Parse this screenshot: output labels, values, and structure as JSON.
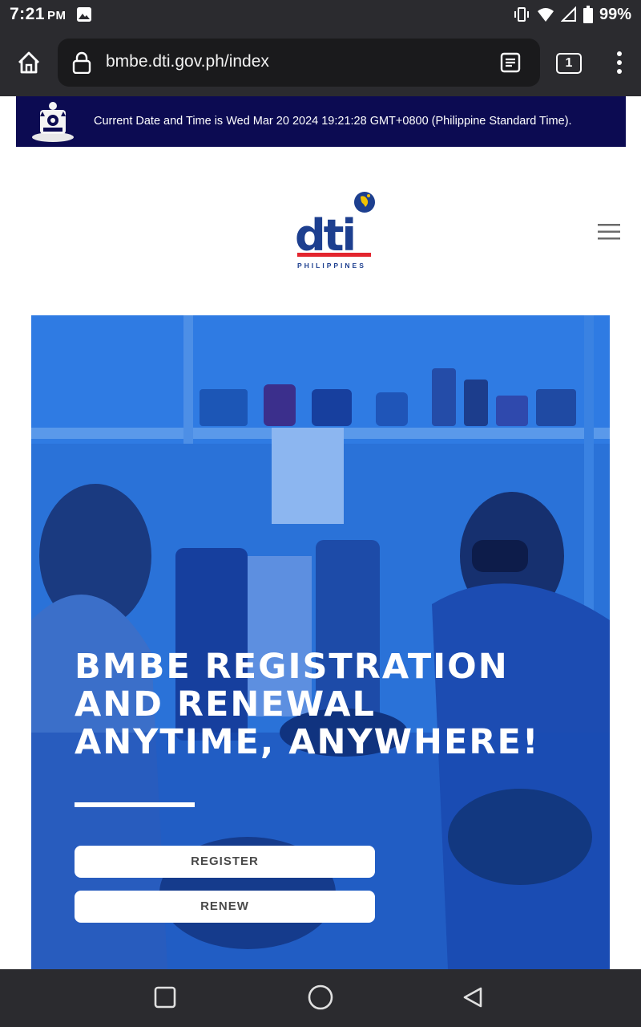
{
  "status_bar": {
    "time": "7:21",
    "ampm": "PM",
    "battery": "99%",
    "icons": [
      "image-icon",
      "vibrate-icon",
      "wifi-icon",
      "signal-icon",
      "battery-icon"
    ]
  },
  "browser": {
    "url": "bmbe.dti.gov.ph/index",
    "tab_count": "1",
    "icons": [
      "home-icon",
      "lock-icon",
      "reader-mode-icon",
      "tabs-icon",
      "overflow-menu-icon"
    ]
  },
  "gov_banner": {
    "text": "Current Date and Time is Wed Mar 20 2024 19:21:28 GMT+0800 (Philippine Standard Time).",
    "seal_icon": "philippine-seal-icon",
    "bg_color": "#0c0b52"
  },
  "header": {
    "logo_text": "dti",
    "logo_subtitle": "PHILIPPINES",
    "menu_icon": "hamburger-icon"
  },
  "hero": {
    "title": "BMBE REGISTRATION AND RENEWAL ANYTIME, ANYWHERE!",
    "register_label": "REGISTER",
    "renew_label": "RENEW",
    "overlay_color": "#2a72d8"
  },
  "nav_bar": {
    "icons": [
      "recents-square-icon",
      "home-circle-icon",
      "back-triangle-icon"
    ]
  }
}
